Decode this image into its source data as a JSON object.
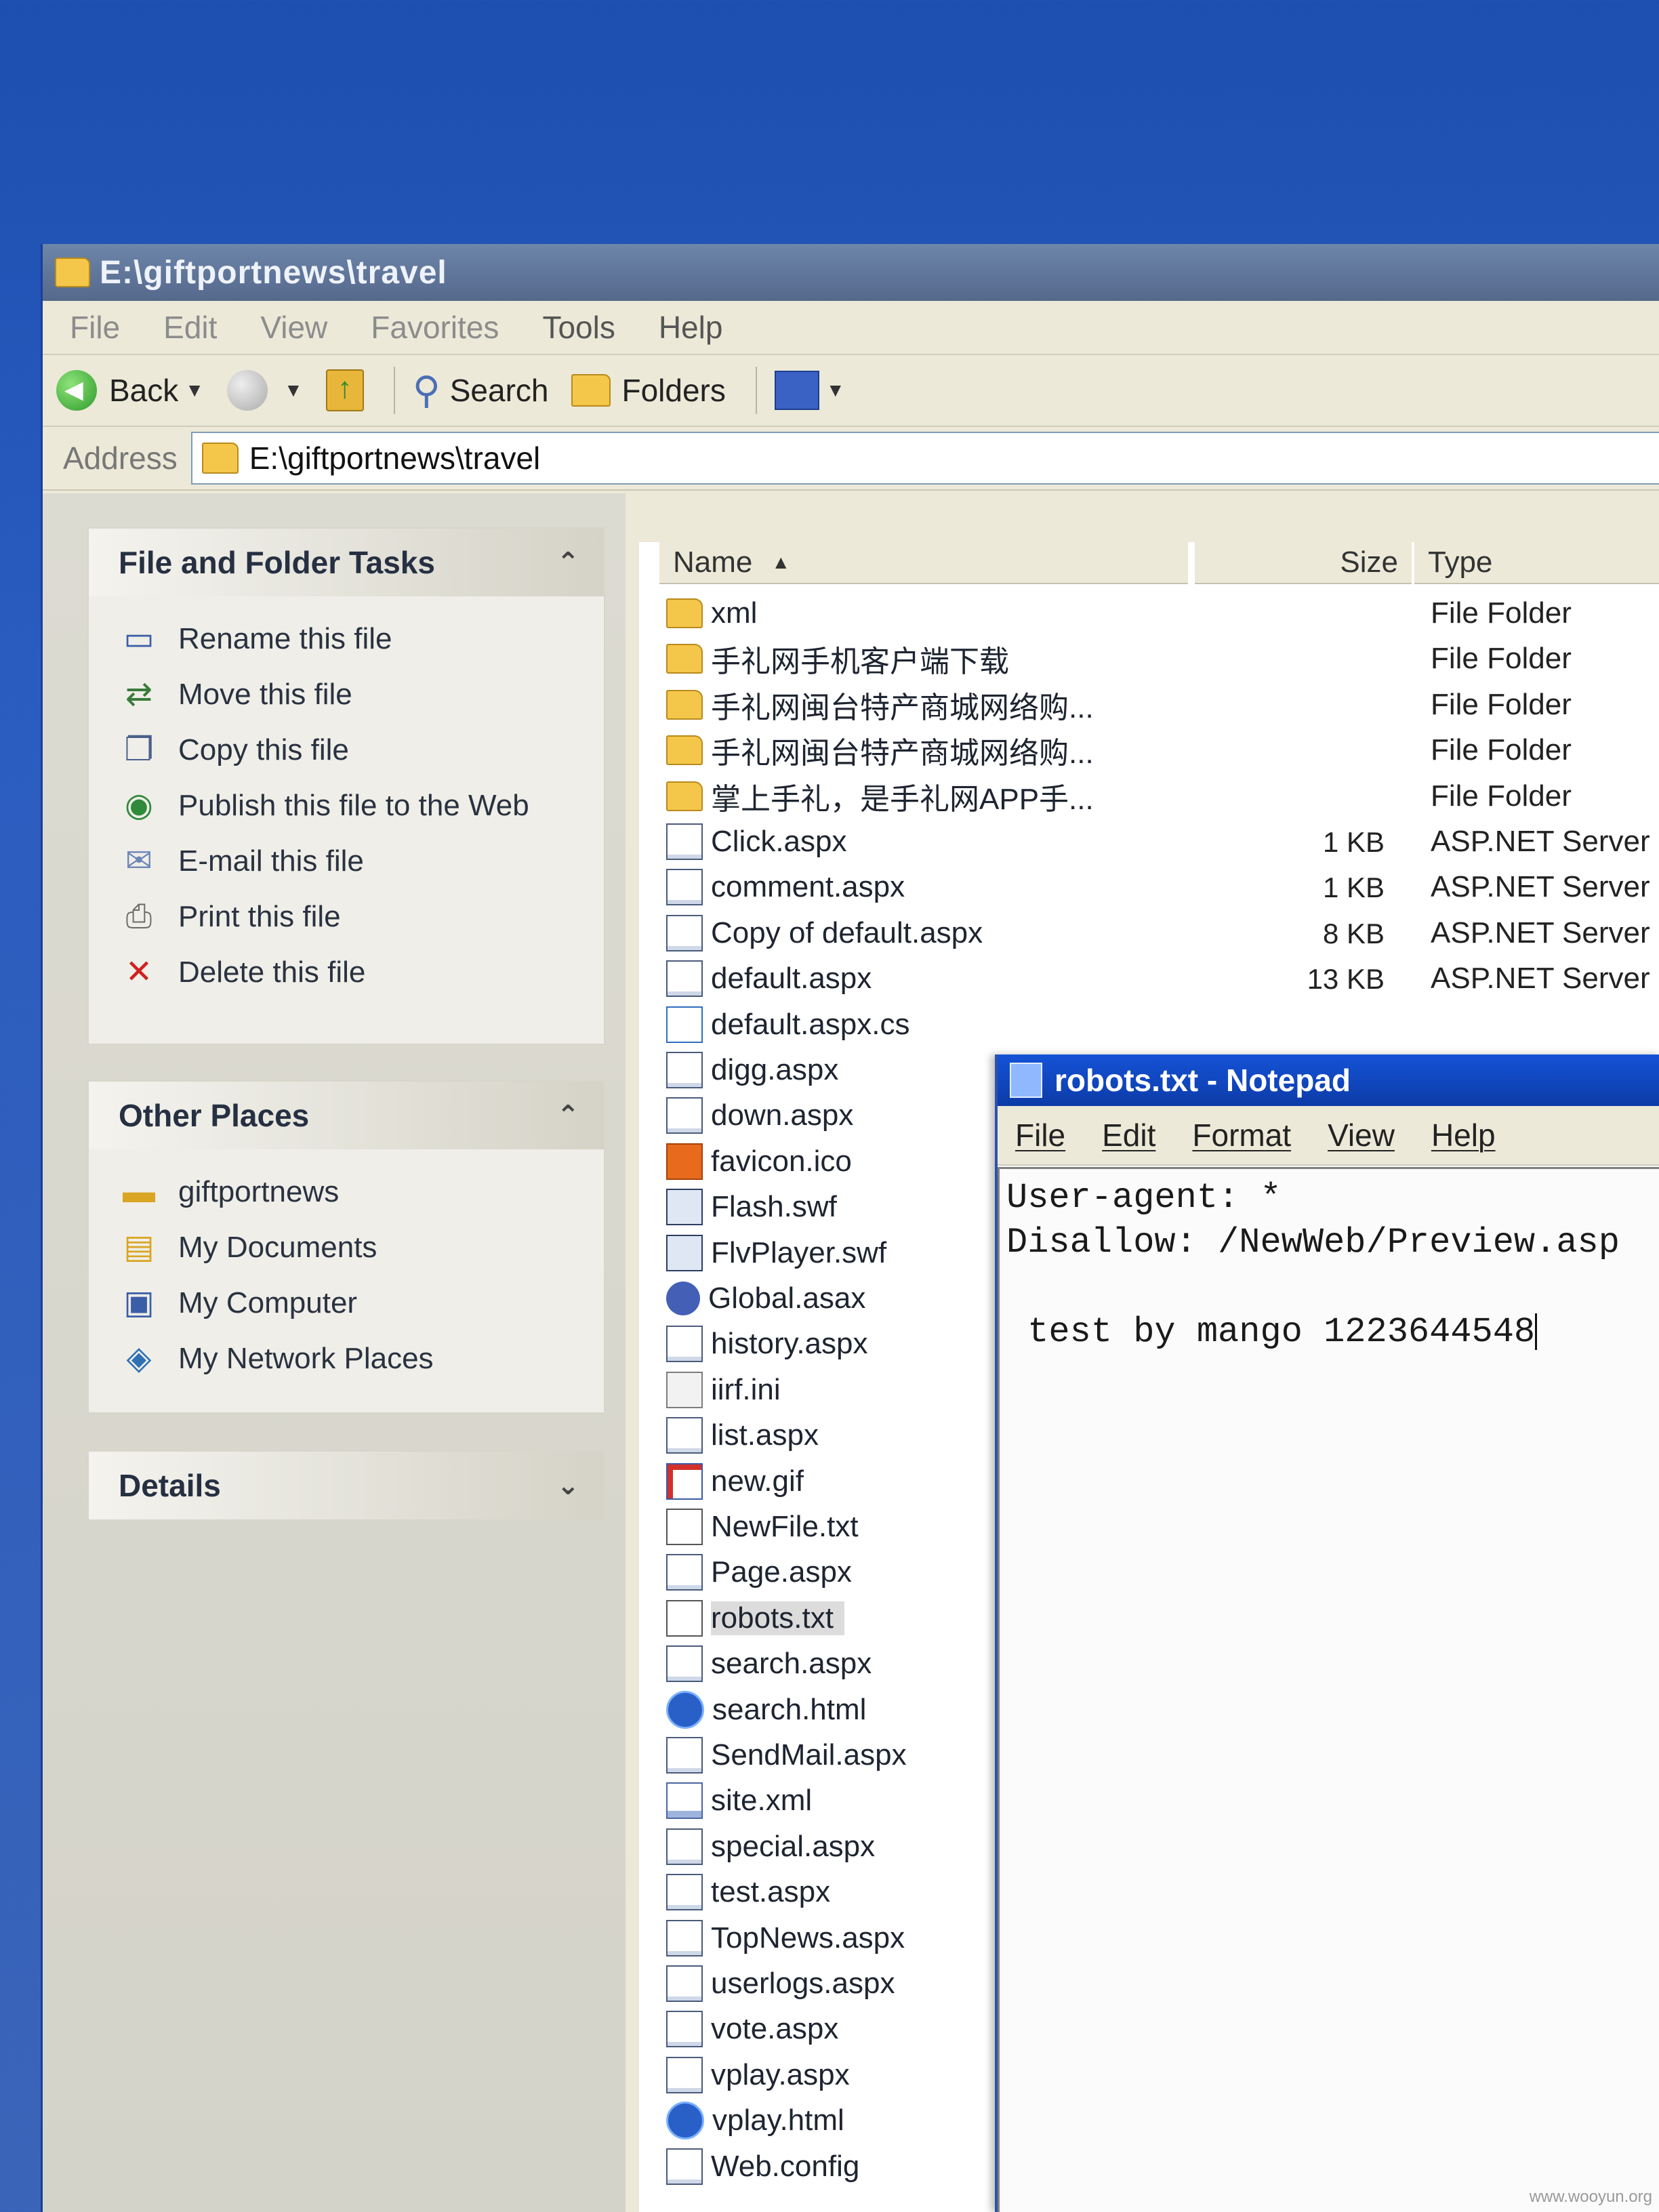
{
  "explorer": {
    "title": "E:\\giftportnews\\travel",
    "menu": [
      "File",
      "Edit",
      "View",
      "Favorites",
      "Tools",
      "Help"
    ],
    "toolbar": {
      "back": "Back",
      "search": "Search",
      "folders": "Folders"
    },
    "address_label": "Address",
    "address_value": "E:\\giftportnews\\travel"
  },
  "sidebar": {
    "file_tasks": {
      "title": "File and Folder Tasks",
      "items": [
        {
          "label": "Rename this file",
          "icon": "rename-icon"
        },
        {
          "label": "Move this file",
          "icon": "move-icon"
        },
        {
          "label": "Copy this file",
          "icon": "copy-icon"
        },
        {
          "label": "Publish this file to the Web",
          "icon": "globe-icon"
        },
        {
          "label": "E-mail this file",
          "icon": "mail-icon"
        },
        {
          "label": "Print this file",
          "icon": "printer-icon"
        },
        {
          "label": "Delete this file",
          "icon": "delete-icon"
        }
      ]
    },
    "other_places": {
      "title": "Other Places",
      "items": [
        {
          "label": "giftportnews",
          "icon": "folder-icon"
        },
        {
          "label": "My Documents",
          "icon": "documents-icon"
        },
        {
          "label": "My Computer",
          "icon": "computer-icon"
        },
        {
          "label": "My Network Places",
          "icon": "network-icon"
        }
      ]
    },
    "details": {
      "title": "Details"
    }
  },
  "filelist": {
    "columns": {
      "name": "Name",
      "size": "Size",
      "type": "Type"
    },
    "rows": [
      {
        "name": "xml",
        "size": "",
        "type": "File Folder",
        "kind": "folder"
      },
      {
        "name": "手礼网手机客户端下载",
        "size": "",
        "type": "File Folder",
        "kind": "folder"
      },
      {
        "name": "手礼网闽台特产商城网络购...",
        "size": "",
        "type": "File Folder",
        "kind": "folder"
      },
      {
        "name": "手礼网闽台特产商城网络购...",
        "size": "",
        "type": "File Folder",
        "kind": "folder"
      },
      {
        "name": "掌上手礼，是手礼网APP手...",
        "size": "",
        "type": "File Folder",
        "kind": "folder"
      },
      {
        "name": "Click.aspx",
        "size": "1 KB",
        "type": "ASP.NET Server",
        "kind": "file"
      },
      {
        "name": "comment.aspx",
        "size": "1 KB",
        "type": "ASP.NET Server",
        "kind": "file"
      },
      {
        "name": "Copy of default.aspx",
        "size": "8 KB",
        "type": "ASP.NET Server",
        "kind": "file"
      },
      {
        "name": "default.aspx",
        "size": "13 KB",
        "type": "ASP.NET Server",
        "kind": "file"
      },
      {
        "name": "default.aspx.cs",
        "size": "",
        "type": "",
        "kind": "cs"
      },
      {
        "name": "digg.aspx",
        "size": "",
        "type": "",
        "kind": "file"
      },
      {
        "name": "down.aspx",
        "size": "",
        "type": "",
        "kind": "file"
      },
      {
        "name": "favicon.ico",
        "size": "",
        "type": "",
        "kind": "ico"
      },
      {
        "name": "Flash.swf",
        "size": "",
        "type": "",
        "kind": "swf"
      },
      {
        "name": "FlvPlayer.swf",
        "size": "",
        "type": "",
        "kind": "swf"
      },
      {
        "name": "Global.asax",
        "size": "",
        "type": "",
        "kind": "gear"
      },
      {
        "name": "history.aspx",
        "size": "",
        "type": "",
        "kind": "file"
      },
      {
        "name": "iirf.ini",
        "size": "",
        "type": "",
        "kind": "ini"
      },
      {
        "name": "list.aspx",
        "size": "",
        "type": "",
        "kind": "file"
      },
      {
        "name": "new.gif",
        "size": "",
        "type": "",
        "kind": "gif"
      },
      {
        "name": "NewFile.txt",
        "size": "",
        "type": "",
        "kind": "txt"
      },
      {
        "name": "Page.aspx",
        "size": "",
        "type": "",
        "kind": "file"
      },
      {
        "name": "robots.txt",
        "size": "",
        "type": "",
        "kind": "txt",
        "selected": true
      },
      {
        "name": "search.aspx",
        "size": "",
        "type": "",
        "kind": "file"
      },
      {
        "name": "search.html",
        "size": "",
        "type": "",
        "kind": "ie"
      },
      {
        "name": "SendMail.aspx",
        "size": "",
        "type": "",
        "kind": "file"
      },
      {
        "name": "site.xml",
        "size": "",
        "type": "",
        "kind": "xml"
      },
      {
        "name": "special.aspx",
        "size": "",
        "type": "",
        "kind": "file"
      },
      {
        "name": "test.aspx",
        "size": "",
        "type": "",
        "kind": "file"
      },
      {
        "name": "TopNews.aspx",
        "size": "",
        "type": "",
        "kind": "file"
      },
      {
        "name": "userlogs.aspx",
        "size": "",
        "type": "",
        "kind": "file"
      },
      {
        "name": "vote.aspx",
        "size": "",
        "type": "",
        "kind": "file"
      },
      {
        "name": "vplay.aspx",
        "size": "",
        "type": "",
        "kind": "file"
      },
      {
        "name": "vplay.html",
        "size": "",
        "type": "",
        "kind": "ie"
      },
      {
        "name": "Web.config",
        "size": "",
        "type": "",
        "kind": "file"
      }
    ]
  },
  "notepad": {
    "title": "robots.txt - Notepad",
    "menu": [
      "File",
      "Edit",
      "Format",
      "View",
      "Help"
    ],
    "content": "User-agent: *\nDisallow: /NewWeb/Preview.asp\n\n test by mango 1223644548"
  },
  "watermark": "www.wooyun.org"
}
